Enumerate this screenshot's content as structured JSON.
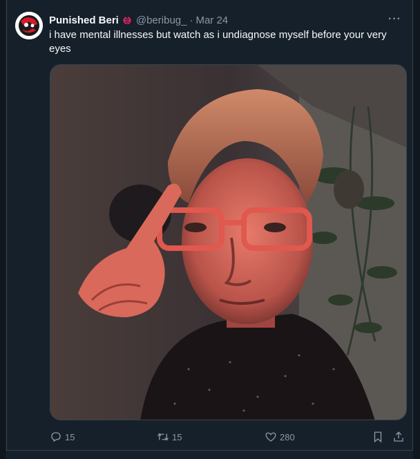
{
  "tweet": {
    "author_name": "Punished Beri",
    "handle": "@beribug_",
    "separator": "·",
    "date": "Mar 24",
    "more_label": "···",
    "text": "i have mental illnesses but watch as i undiagnose myself before your very eyes"
  },
  "actions": {
    "replies": "15",
    "retweets": "15",
    "likes": "280"
  },
  "colors": {
    "background": "#15202b",
    "secondary_text": "#8b98a5",
    "border": "#38444d",
    "badge": "#e0245e"
  },
  "icons": [
    "reply-icon",
    "retweet-icon",
    "like-icon",
    "bookmark-icon",
    "share-icon",
    "ladybug-badge-icon"
  ]
}
